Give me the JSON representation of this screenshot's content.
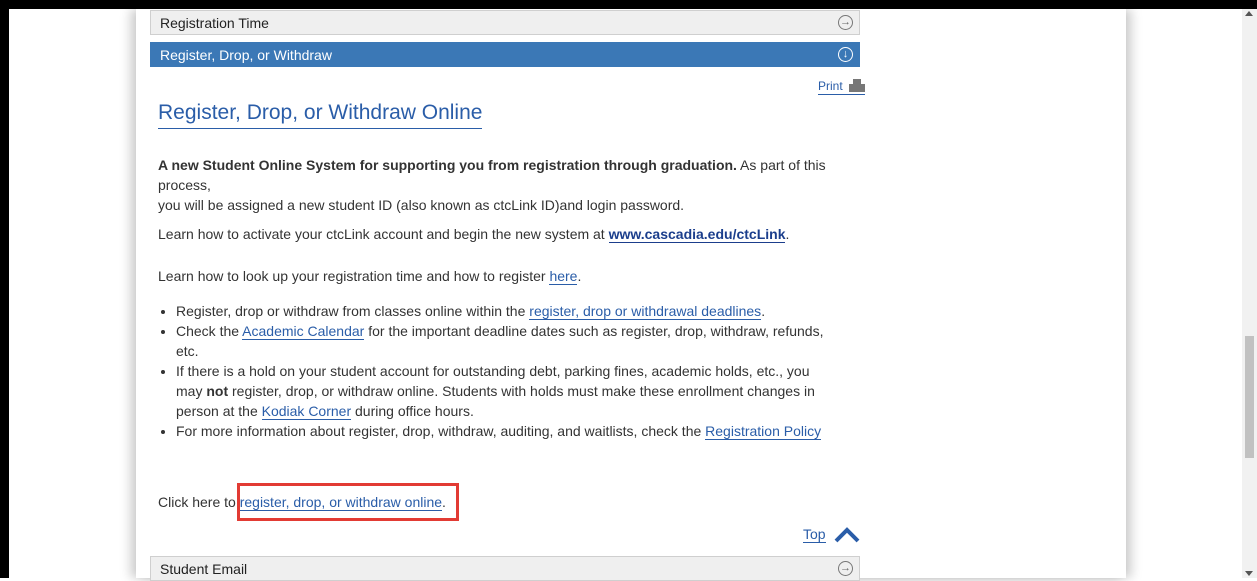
{
  "accordion": {
    "registration_time": "Registration Time",
    "register_drop": "Register, Drop, or Withdraw",
    "student_email": "Student Email"
  },
  "print_label": "Print",
  "section_title": "Register, Drop, or Withdraw Online",
  "intro": {
    "bold": "A new Student Online System for supporting you from registration through graduation.",
    "rest_line1": " As part of this process,",
    "line2": "you will be assigned a new student ID (also known as ctcLink ID)and login password."
  },
  "activate": {
    "text": "Learn how to activate your ctcLink account and begin the new system at ",
    "link": "www.cascadia.edu/ctcLink",
    "end": "."
  },
  "lookup": {
    "text": "Learn how to look up your registration time and how to register ",
    "link": "here",
    "end": "."
  },
  "bullets": {
    "b1_text": "Register, drop or withdraw from classes online within the ",
    "b1_link": "register, drop or withdrawal deadlines",
    "b1_end": ".",
    "b2_text": "Check the ",
    "b2_link": "Academic Calendar",
    "b2_rest": " for the important deadline dates such as register, drop, withdraw, refunds,",
    "b2_line2": "etc.",
    "b3_line1": "If there is a hold on your student account for outstanding debt, parking fines, academic holds, etc., you",
    "b3_may": "may ",
    "b3_not": "not",
    "b3_line2_rest": " register, drop, or withdraw online. Students with holds must make these enrollment changes in",
    "b3_line3_pre": "person at the ",
    "b3_link": "Kodiak Corner",
    "b3_line3_post": " during office hours.",
    "b4_text": "For more information about register, drop, withdraw, auditing, and waitlists, check the ",
    "b4_link": "Registration Policy"
  },
  "click_here": {
    "text": "Click here to ",
    "link": "register, drop, or withdraw online",
    "end": "."
  },
  "top_label": "Top"
}
